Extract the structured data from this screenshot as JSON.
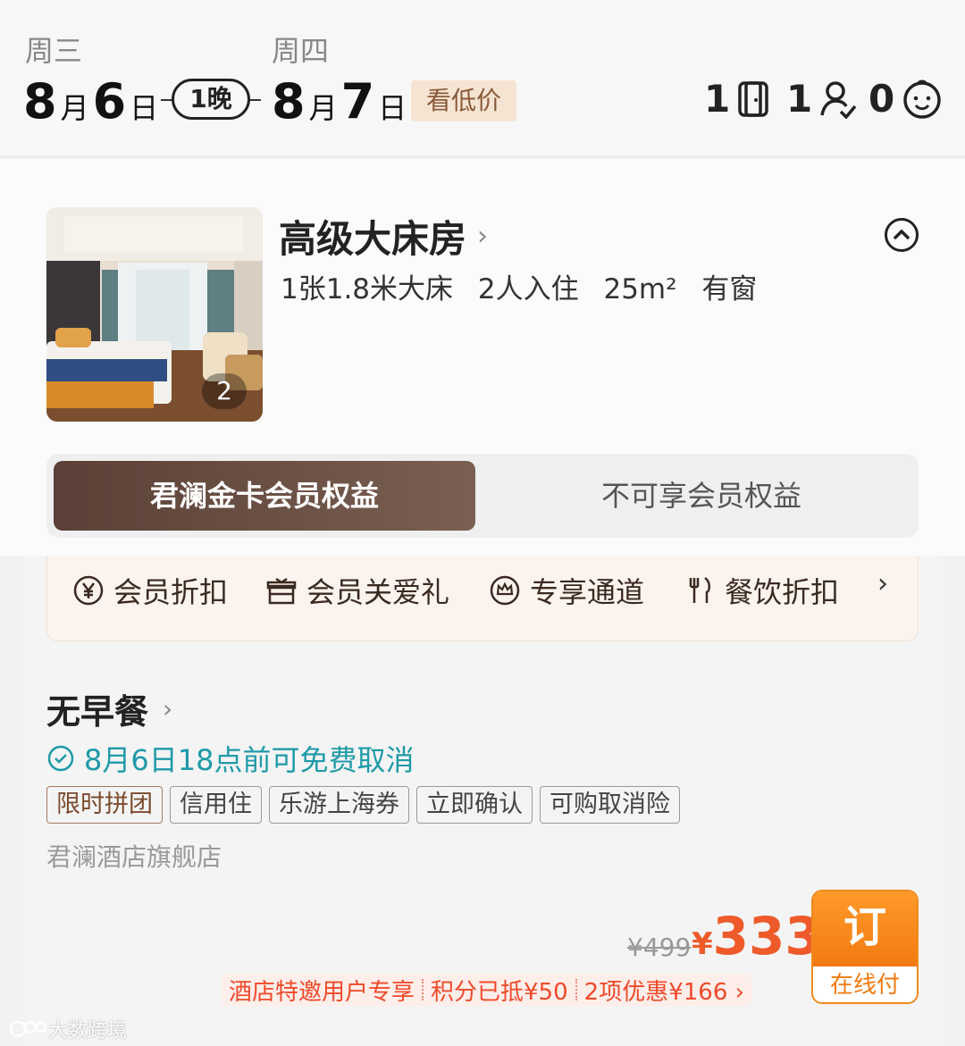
{
  "header": {
    "checkin": {
      "weekday": "周三",
      "month": "8",
      "month_unit": "月",
      "day": "6",
      "day_unit": "日"
    },
    "checkout": {
      "weekday": "周四",
      "month": "8",
      "month_unit": "月",
      "day": "7",
      "day_unit": "日"
    },
    "nights_label": "1晚",
    "low_price_label": "看低价",
    "occupancy": {
      "rooms": "1",
      "adults": "1",
      "children": "0"
    }
  },
  "room": {
    "title": "高级大床房",
    "title_chevron": "›",
    "specs": [
      "1张1.8米大床",
      "2人入住",
      "25m²",
      "有窗"
    ],
    "photo_count": "2"
  },
  "member_tabs": {
    "active": "君澜金卡会员权益",
    "inactive": "不可享会员权益"
  },
  "benefits": {
    "items": [
      {
        "label": "会员折扣",
        "icon": "yen-circle-icon"
      },
      {
        "label": "会员关爱礼",
        "icon": "gift-icon"
      },
      {
        "label": "专享通道",
        "icon": "crown-circle-icon"
      },
      {
        "label": "餐饮折扣",
        "icon": "cutlery-icon"
      }
    ],
    "more": "›"
  },
  "rate": {
    "meal": "无早餐",
    "meal_chevron": "›",
    "cancel_policy": "8月6日18点前可免费取消",
    "tags": [
      "限时拼团",
      "信用住",
      "乐游上海券",
      "立即确认",
      "可购取消险"
    ],
    "store": "君澜酒店旗舰店",
    "original_price": "¥499",
    "currency": "¥",
    "price": "333",
    "book_label": "订",
    "pay_label": "在线付",
    "promo": [
      "酒店特邀用户专享",
      "积分已抵¥50",
      "2项优惠¥166 ›"
    ]
  },
  "watermark": "大数跨境",
  "colors": {
    "accent": "#ee5a2a",
    "book": "#f27a10",
    "teal": "#1f9aa8",
    "member_brown": "#5a4036"
  }
}
